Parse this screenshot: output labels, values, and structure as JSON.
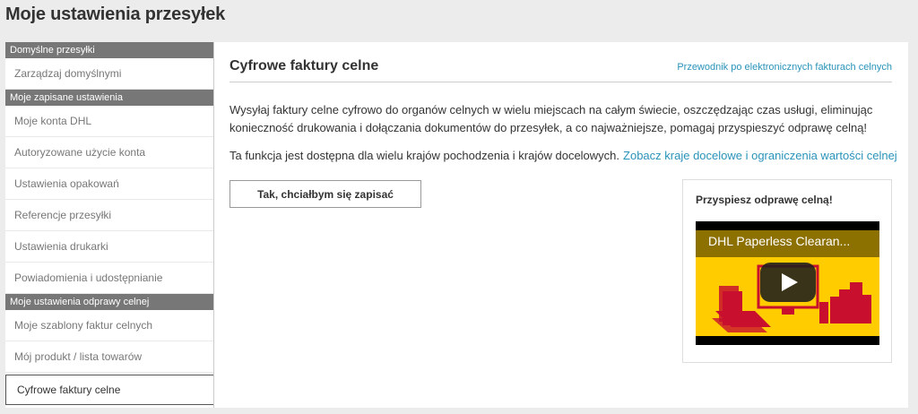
{
  "page_title": "Moje ustawienia przesyłek",
  "sidebar": {
    "sections": [
      {
        "heading": "Domyślne przesyłki",
        "items": [
          "Zarządzaj domyślnymi"
        ]
      },
      {
        "heading": "Moje zapisane ustawienia",
        "items": [
          "Moje konta DHL",
          "Autoryzowane użycie konta",
          "Ustawienia opakowań",
          "Referencje przesyłki",
          "Ustawienia drukarki",
          "Powiadomienia i udostępnianie"
        ]
      },
      {
        "heading": "Moje ustawienia odprawy celnej",
        "items": [
          "Moje szablony faktur celnych",
          "Mój produkt / lista towarów",
          "Cyfrowe faktury celne"
        ]
      }
    ],
    "active_item": "Cyfrowe faktury celne"
  },
  "main": {
    "title": "Cyfrowe faktury celne",
    "guide_link": "Przewodnik po elektronicznych fakturach celnych",
    "description": "Wysyłaj faktury celne cyfrowo do organów celnych w wielu miejscach na całym świecie, oszczędzając czas usługi, eliminując konieczność drukowania i dołączania dokumentów do przesyłek, a co najważniejsze, pomagaj przyspieszyć odprawę celną!",
    "availability_text": "Ta funkcja jest dostępna dla wielu krajów pochodzenia i krajów docelowych.",
    "availability_link": "Zobacz kraje docelowe i ograniczenia wartości celnej",
    "signup_button": "Tak, chciałbym się zapisać"
  },
  "promo": {
    "title": "Przyspiesz odprawę celną!",
    "video_title": "DHL Paperless Clearan...",
    "colors": {
      "video_bg": "#ffcc00",
      "art": "#c8102e"
    }
  },
  "colors": {
    "link": "#2a93b9",
    "section_header": "#777777",
    "background": "#ececec"
  }
}
